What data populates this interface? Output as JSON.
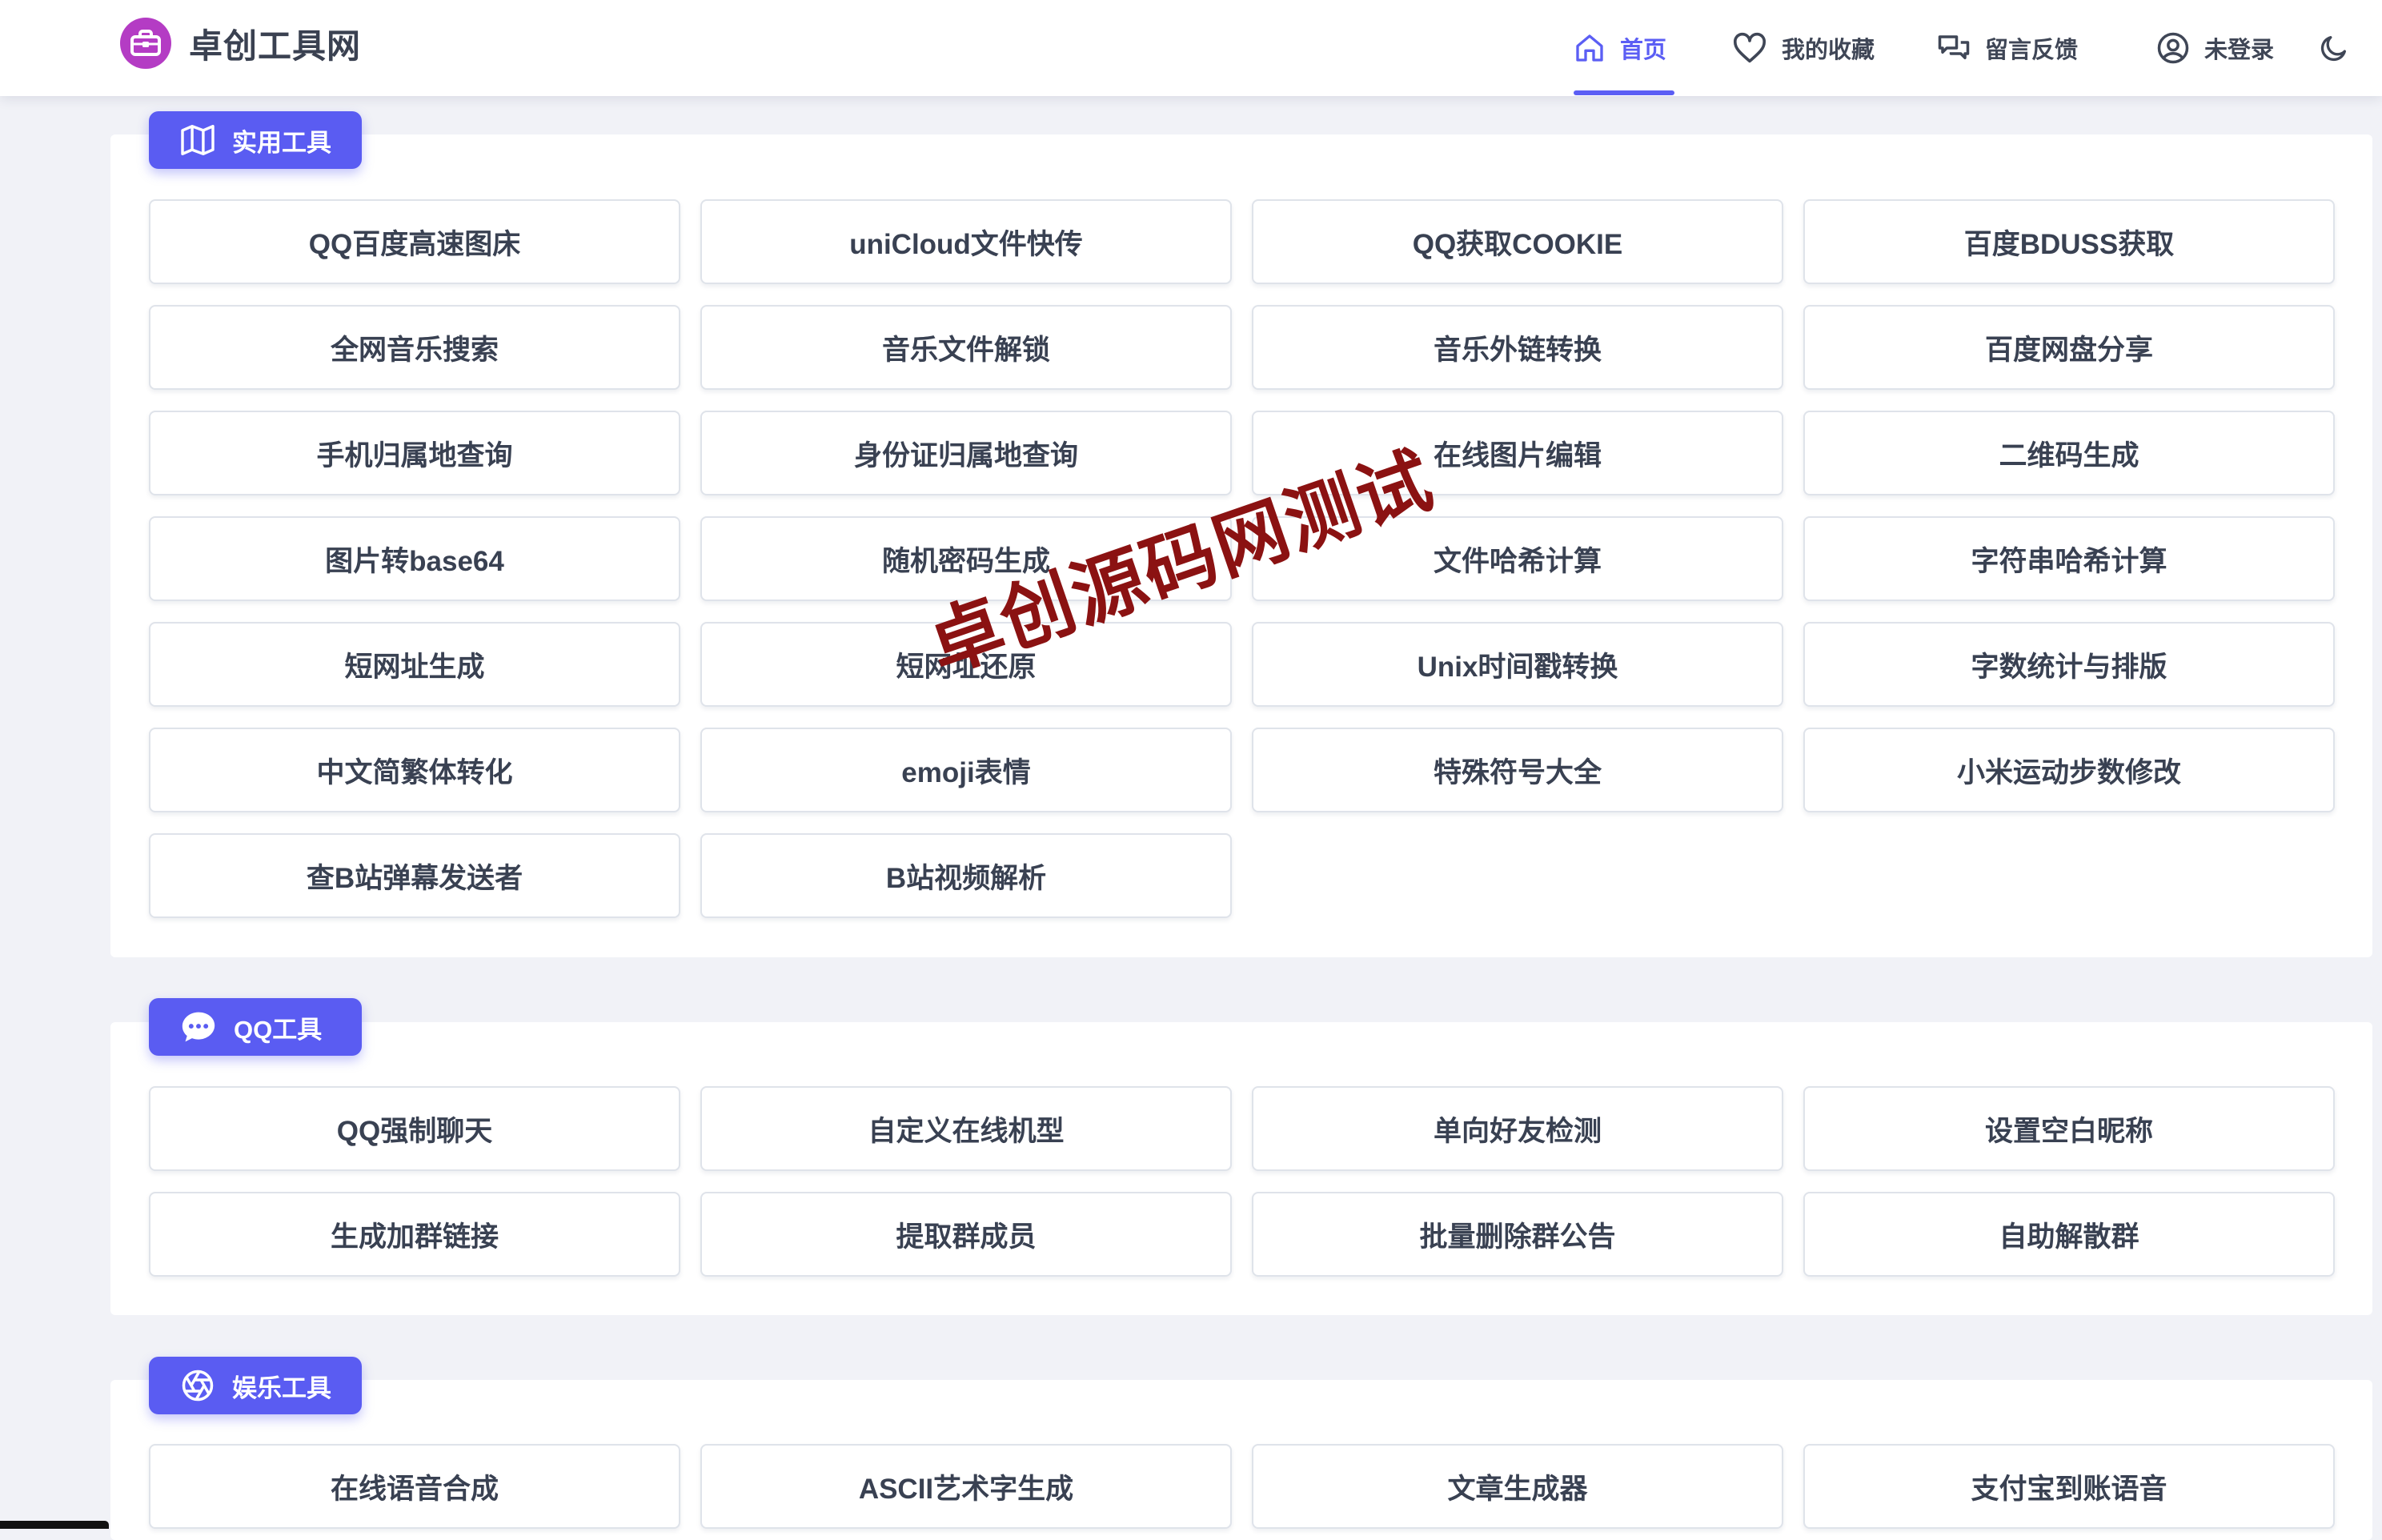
{
  "header": {
    "site_name": "卓创工具网",
    "nav": [
      {
        "label": "首页",
        "icon": "home-icon",
        "active": true
      },
      {
        "label": "我的收藏",
        "icon": "heart-icon"
      },
      {
        "label": "留言反馈",
        "icon": "chat-icon"
      },
      {
        "label": "未登录",
        "icon": "user-icon"
      }
    ],
    "theme_toggle_icon": "moon-icon"
  },
  "colors": {
    "accent": "#5b5ef4",
    "logo": "#b43cc4",
    "watermark": "#8b1212"
  },
  "sections": [
    {
      "title": "实用工具",
      "icon": "map-icon",
      "tools": [
        "QQ百度高速图床",
        "uniCloud文件快传",
        "QQ获取COOKIE",
        "百度BDUSS获取",
        "全网音乐搜索",
        "音乐文件解锁",
        "音乐外链转换",
        "百度网盘分享",
        "手机归属地查询",
        "身份证归属地查询",
        "在线图片编辑",
        "二维码生成",
        "图片转base64",
        "随机密码生成",
        "文件哈希计算",
        "字符串哈希计算",
        "短网址生成",
        "短网址还原",
        "Unix时间戳转换",
        "字数统计与排版",
        "中文简繁体转化",
        "emoji表情",
        "特殊符号大全",
        "小米运动步数修改",
        "查B站弹幕发送者",
        "B站视频解析"
      ]
    },
    {
      "title": "QQ工具",
      "icon": "message-bubble-icon",
      "tools": [
        "QQ强制聊天",
        "自定义在线机型",
        "单向好友检测",
        "设置空白昵称",
        "生成加群链接",
        "提取群成员",
        "批量删除群公告",
        "自助解散群"
      ]
    },
    {
      "title": "娱乐工具",
      "icon": "aperture-icon",
      "tools": [
        "在线语音合成",
        "ASCII艺术字生成",
        "文章生成器",
        "支付宝到账语音"
      ]
    }
  ],
  "watermark": "卓创源码网测试"
}
